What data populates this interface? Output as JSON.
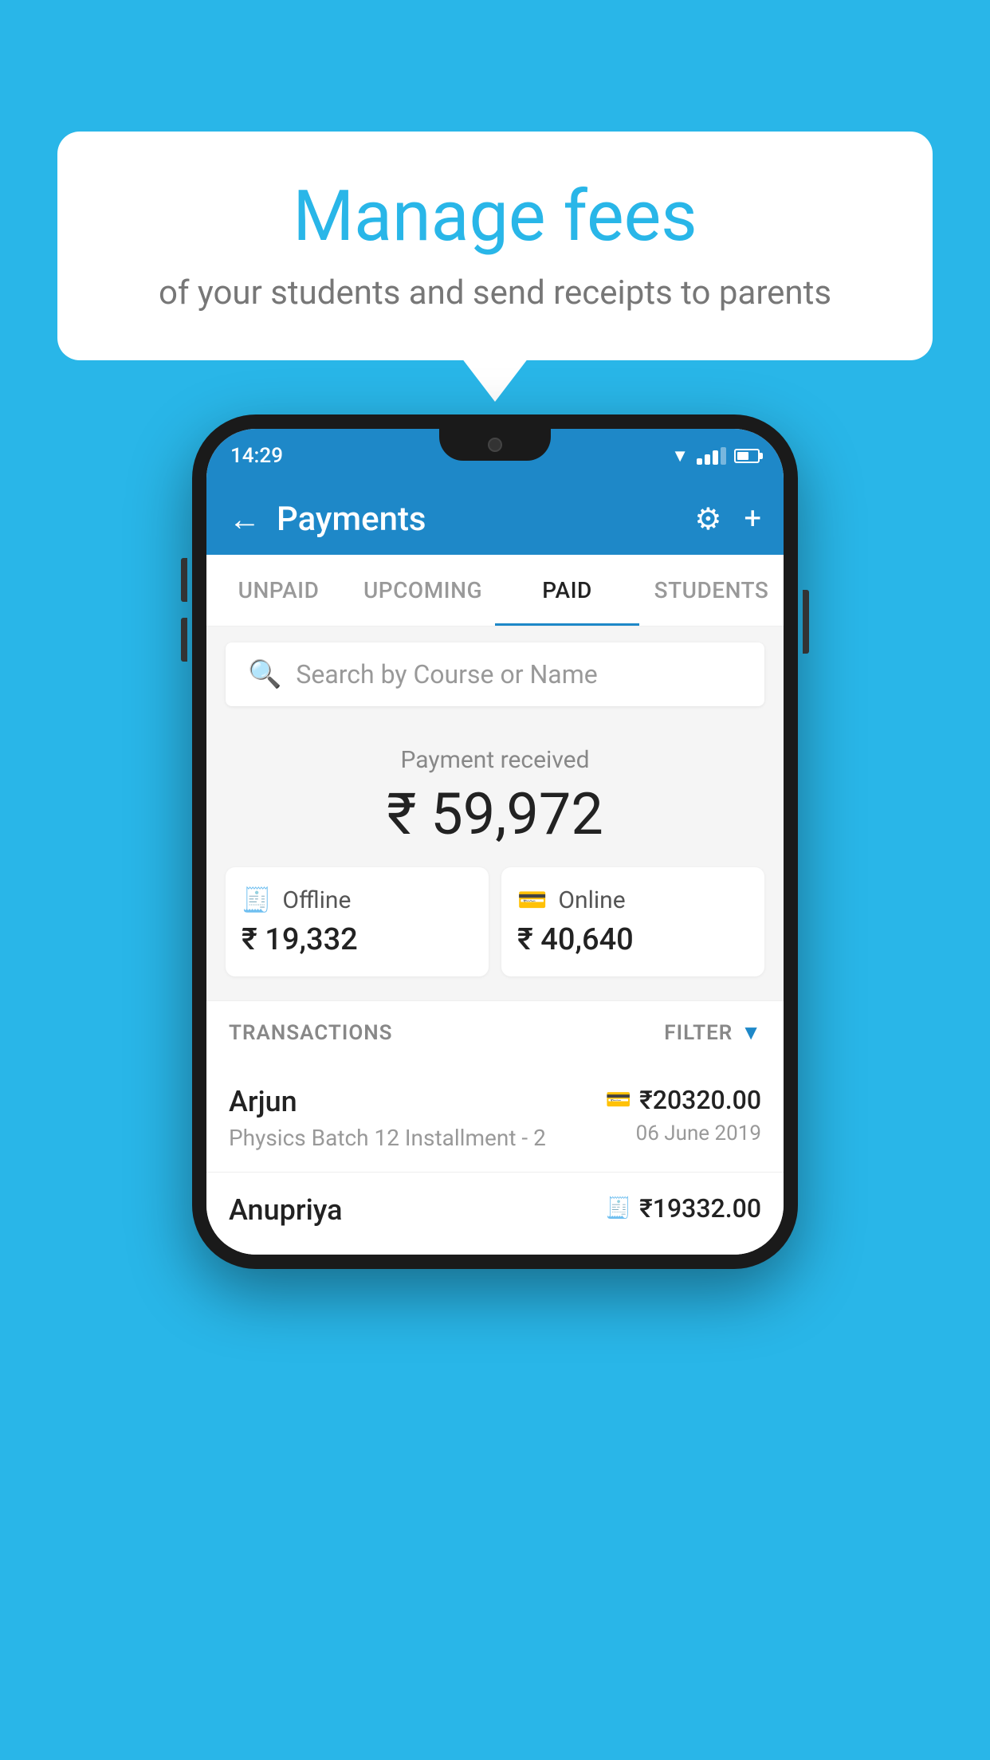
{
  "background_color": "#29B6E8",
  "speech_bubble": {
    "title": "Manage fees",
    "subtitle": "of your students and send receipts to parents"
  },
  "status_bar": {
    "time": "14:29"
  },
  "app_header": {
    "title": "Payments",
    "back_label": "←",
    "gear_label": "⚙",
    "plus_label": "+"
  },
  "tabs": [
    {
      "label": "UNPAID",
      "active": false
    },
    {
      "label": "UPCOMING",
      "active": false
    },
    {
      "label": "PAID",
      "active": true
    },
    {
      "label": "STUDENTS",
      "active": false
    }
  ],
  "search": {
    "placeholder": "Search by Course or Name"
  },
  "payment_summary": {
    "label": "Payment received",
    "amount": "₹ 59,972",
    "offline": {
      "type": "Offline",
      "amount": "₹ 19,332"
    },
    "online": {
      "type": "Online",
      "amount": "₹ 40,640"
    }
  },
  "transactions": {
    "label": "TRANSACTIONS",
    "filter_label": "FILTER",
    "rows": [
      {
        "name": "Arjun",
        "details": "Physics Batch 12 Installment - 2",
        "amount": "₹20320.00",
        "date": "06 June 2019",
        "payment_type": "card"
      },
      {
        "name": "Anupriya",
        "details": "",
        "amount": "₹19332.00",
        "date": "",
        "payment_type": "offline"
      }
    ]
  }
}
